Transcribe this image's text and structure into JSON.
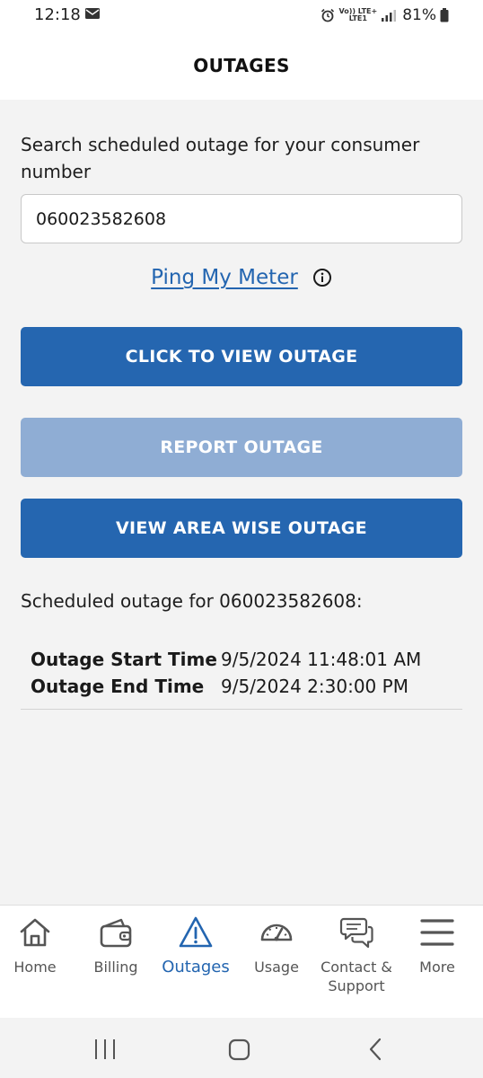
{
  "status_bar": {
    "time": "12:18",
    "network_top": "Vo)) LTE+",
    "network_bottom": "LTE1",
    "battery": "81%"
  },
  "header": {
    "title": "OUTAGES"
  },
  "search": {
    "label": "Search scheduled outage for your consumer number",
    "value": "060023582608"
  },
  "ping": {
    "link_label": "Ping My Meter",
    "info_icon": "info-circle-icon"
  },
  "buttons": {
    "view_outage": "CLICK TO VIEW OUTAGE",
    "report_outage": "REPORT OUTAGE",
    "area_outage": "VIEW AREA WISE OUTAGE"
  },
  "schedule": {
    "heading": "Scheduled outage for 060023582608:",
    "rows": [
      {
        "key": "Outage Start Time",
        "value": "9/5/2024 11:48:01 AM"
      },
      {
        "key": "Outage End Time",
        "value": "9/5/2024 2:30:00 PM"
      }
    ]
  },
  "nav": {
    "items": [
      {
        "label": "Home",
        "icon": "home-icon"
      },
      {
        "label": "Billing",
        "icon": "wallet-icon"
      },
      {
        "label": "Outages",
        "icon": "warning-icon",
        "active": true
      },
      {
        "label": "Usage",
        "icon": "gauge-icon"
      },
      {
        "label": "Contact & Support",
        "icon": "chat-bubbles-icon"
      },
      {
        "label": "More",
        "icon": "menu-icon"
      }
    ]
  },
  "colors": {
    "primary": "#2566b0",
    "primary_disabled": "#8fadd4",
    "link": "#2365b0",
    "background": "#f3f3f3"
  }
}
